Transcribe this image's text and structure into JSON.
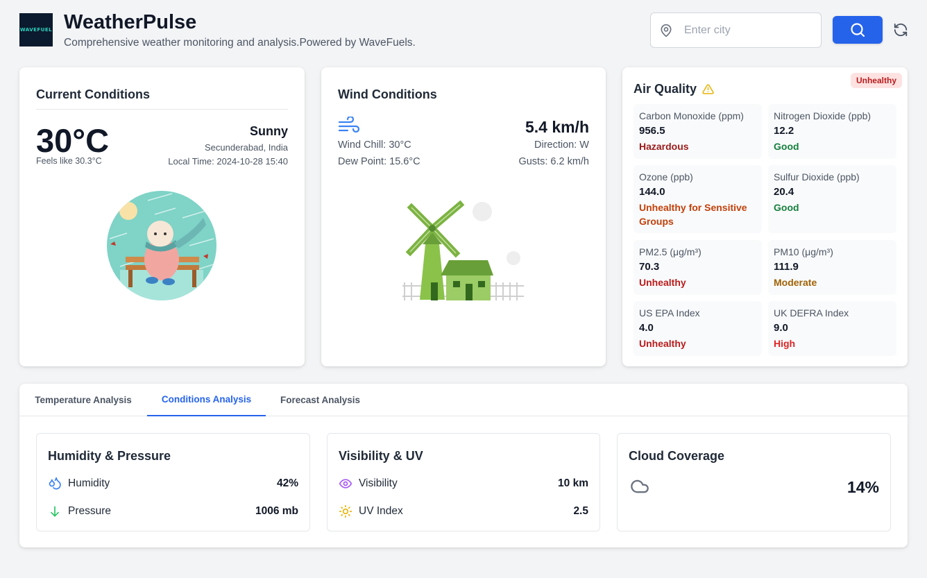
{
  "header": {
    "logo_text": "WAVEFUEL",
    "title": "WeatherPulse",
    "subtitle": "Comprehensive weather monitoring and analysis.Powered by WaveFuels.",
    "search_placeholder": "Enter city",
    "search_value": ""
  },
  "current": {
    "title": "Current Conditions",
    "temperature": "30°C",
    "feels_like": "Feels like 30.3°C",
    "condition": "Sunny",
    "location": "Secunderabad, India",
    "local_time": "Local Time: 2024-10-28 15:40"
  },
  "wind": {
    "title": "Wind Conditions",
    "speed": "5.4 km/h",
    "wind_chill": "Wind Chill: 30°C",
    "dew_point": "Dew Point: 15.6°C",
    "direction": "Direction: W",
    "gusts": "Gusts: 6.2 km/h"
  },
  "air_quality": {
    "title": "Air Quality",
    "badge": "Unhealthy",
    "metrics": [
      {
        "label": "Carbon Monoxide (ppm)",
        "value": "956.5",
        "status": "Hazardous",
        "color": "#991b1b"
      },
      {
        "label": "Nitrogen Dioxide (ppb)",
        "value": "12.2",
        "status": "Good",
        "color": "#15803d"
      },
      {
        "label": "Ozone (ppb)",
        "value": "144.0",
        "status": "Unhealthy for Sensitive Groups",
        "color": "#c2410c"
      },
      {
        "label": "Sulfur Dioxide (ppb)",
        "value": "20.4",
        "status": "Good",
        "color": "#15803d"
      },
      {
        "label": "PM2.5 (μg/m³)",
        "value": "70.3",
        "status": "Unhealthy",
        "color": "#b91c1c"
      },
      {
        "label": "PM10 (μg/m³)",
        "value": "111.9",
        "status": "Moderate",
        "color": "#a16207"
      },
      {
        "label": "US EPA Index",
        "value": "4.0",
        "status": "Unhealthy",
        "color": "#b91c1c"
      },
      {
        "label": "UK DEFRA Index",
        "value": "9.0",
        "status": "High",
        "color": "#dc2626"
      }
    ]
  },
  "tabs": [
    {
      "label": "Temperature Analysis",
      "active": false
    },
    {
      "label": "Conditions Analysis",
      "active": true
    },
    {
      "label": "Forecast Analysis",
      "active": false
    }
  ],
  "conditions": {
    "humidity_pressure": {
      "title": "Humidity & Pressure",
      "humidity_label": "Humidity",
      "humidity_value": "42%",
      "pressure_label": "Pressure",
      "pressure_value": "1006 mb"
    },
    "visibility_uv": {
      "title": "Visibility & UV",
      "visibility_label": "Visibility",
      "visibility_value": "10 km",
      "uv_label": "UV Index",
      "uv_value": "2.5"
    },
    "cloud": {
      "title": "Cloud Coverage",
      "value": "14%"
    }
  },
  "colors": {
    "accent": "#2563eb",
    "background": "#f3f4f6"
  }
}
